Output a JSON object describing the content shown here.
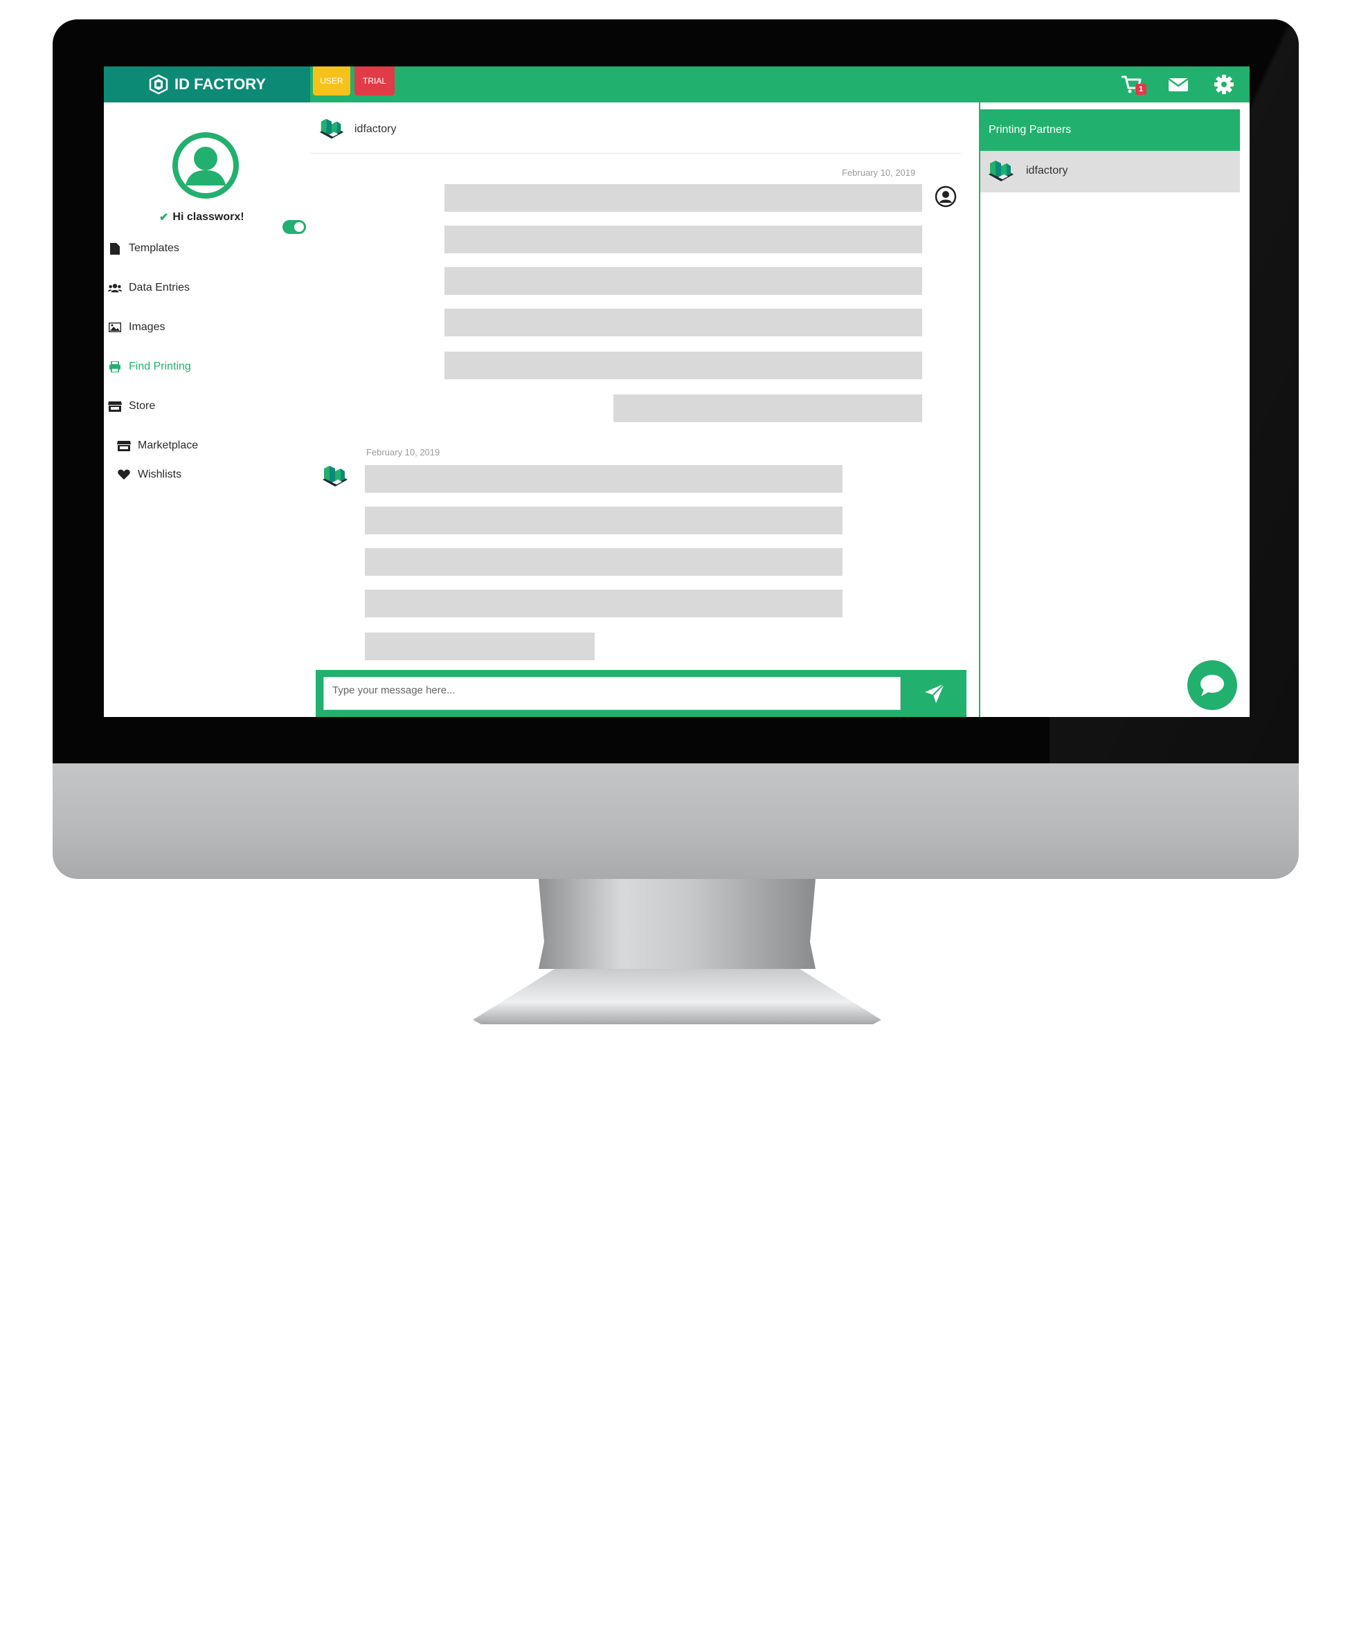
{
  "brand": {
    "name": "ID FACTORY"
  },
  "badges": {
    "user": "USER",
    "trial": "TRIAL"
  },
  "topbar": {
    "cart_count": "1"
  },
  "colors": {
    "primary": "#22b06e",
    "brand_bg": "#0c8a76",
    "user_badge": "#f5c21b",
    "trial_badge": "#e03b47"
  },
  "sidebar": {
    "greeting": "Hi classworx!",
    "toggle_on": true,
    "items": [
      {
        "label": "Templates",
        "icon": "file-icon"
      },
      {
        "label": "Data Entries",
        "icon": "users-icon"
      },
      {
        "label": "Images",
        "icon": "image-icon"
      },
      {
        "label": "Find Printing",
        "icon": "printer-icon",
        "active": true
      },
      {
        "label": "Store",
        "icon": "store-icon"
      }
    ],
    "sub_items": [
      {
        "label": "Marketplace",
        "icon": "store-icon"
      },
      {
        "label": "Wishlists",
        "icon": "heart-icon"
      }
    ]
  },
  "chat": {
    "contact_name": "idfactory",
    "messages": [
      {
        "from": "user",
        "date": "February 10, 2019"
      },
      {
        "from": "idfactory",
        "date": "February 10, 2019"
      }
    ],
    "input_placeholder": "Type your message here..."
  },
  "partners": {
    "title": "Printing Partners",
    "items": [
      {
        "name": "idfactory"
      }
    ]
  }
}
